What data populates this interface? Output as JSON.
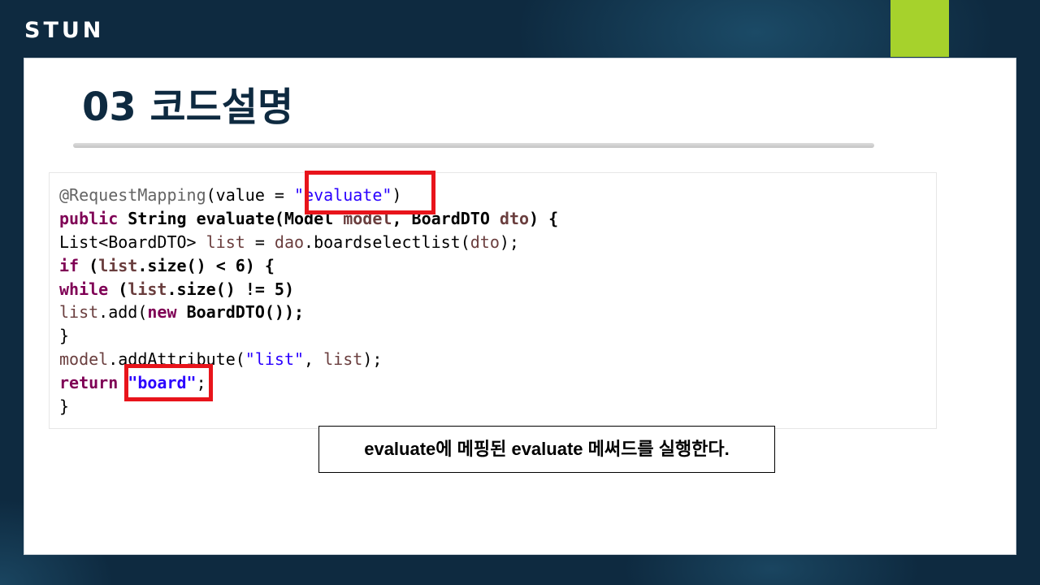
{
  "header": {
    "brand": "STUN"
  },
  "slide": {
    "title": "03 코드설명",
    "code_lines": [
      [
        {
          "t": "@RequestMapping",
          "c": "annot"
        },
        {
          "t": "(value = ",
          "c": "plain"
        },
        {
          "t": "\"evaluate\"",
          "c": "str"
        },
        {
          "t": ")",
          "c": "plain"
        }
      ],
      [
        {
          "t": "public",
          "c": "kw"
        },
        {
          "t": " ",
          "c": "plain"
        },
        {
          "t": "String evaluate(Model",
          "c": "b"
        },
        {
          "t": " ",
          "c": "plain"
        },
        {
          "t": "model",
          "c": "var b"
        },
        {
          "t": ", ",
          "c": "b"
        },
        {
          "t": "BoardDTO",
          "c": "b"
        },
        {
          "t": " ",
          "c": "plain"
        },
        {
          "t": "dto",
          "c": "var b"
        },
        {
          "t": ") {",
          "c": "b"
        }
      ],
      [
        {
          "t": "List<BoardDTO> ",
          "c": "plain"
        },
        {
          "t": "list",
          "c": "var"
        },
        {
          "t": " = ",
          "c": "plain"
        },
        {
          "t": "dao",
          "c": "var"
        },
        {
          "t": ".boardselectlist(",
          "c": "plain"
        },
        {
          "t": "dto",
          "c": "var"
        },
        {
          "t": ");",
          "c": "plain"
        }
      ],
      [
        {
          "t": "if",
          "c": "kw"
        },
        {
          "t": " (",
          "c": "b"
        },
        {
          "t": "list",
          "c": "var b"
        },
        {
          "t": ".size() < 6) {",
          "c": "b"
        }
      ],
      [
        {
          "t": "while",
          "c": "kw"
        },
        {
          "t": " (",
          "c": "b"
        },
        {
          "t": "list",
          "c": "var b"
        },
        {
          "t": ".size() != 5)",
          "c": "b"
        }
      ],
      [
        {
          "t": "list",
          "c": "var"
        },
        {
          "t": ".add(",
          "c": "plain"
        },
        {
          "t": "new",
          "c": "kw"
        },
        {
          "t": " ",
          "c": "plain"
        },
        {
          "t": "BoardDTO());",
          "c": "b"
        }
      ],
      [
        {
          "t": "}",
          "c": "plain"
        }
      ],
      [
        {
          "t": "model",
          "c": "var"
        },
        {
          "t": ".addAttribute(",
          "c": "plain"
        },
        {
          "t": "\"list\"",
          "c": "str"
        },
        {
          "t": ", ",
          "c": "plain"
        },
        {
          "t": "list",
          "c": "var"
        },
        {
          "t": ");",
          "c": "plain"
        }
      ],
      [
        {
          "t": "return",
          "c": "kw"
        },
        {
          "t": " ",
          "c": "plain"
        },
        {
          "t": "\"board\"",
          "c": "str b"
        },
        {
          "t": ";",
          "c": "plain"
        }
      ],
      [
        {
          "t": "}",
          "c": "plain"
        }
      ]
    ],
    "caption": "evaluate에 메핑된 evaluate 메써드를 실행한다."
  },
  "colors": {
    "background": "#0e2a40",
    "accent": "#a6d22c",
    "highlight": "#e8141b",
    "keyword": "#7f0055",
    "string": "#2a00ff",
    "variable": "#6a3e3e",
    "annotation": "#646464"
  }
}
